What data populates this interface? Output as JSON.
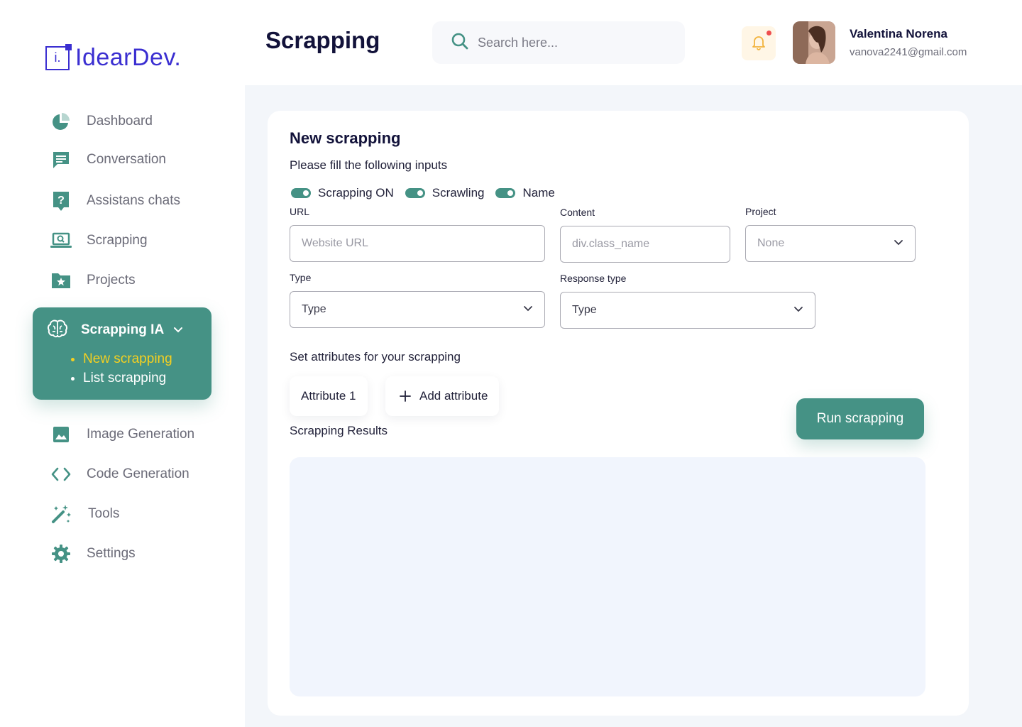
{
  "brand": {
    "logo_glyph": "i.",
    "name": "IdearDev.",
    "color": "#3b2fd1"
  },
  "colors": {
    "accent": "#459285",
    "active_sub": "#f5d020",
    "content_bg": "#f3f6fa",
    "notification_dot": "#ef4e4e"
  },
  "sidebar": {
    "items": [
      {
        "label": "Dashboard",
        "icon": "pie-chart-icon"
      },
      {
        "label": "Conversation",
        "icon": "chat-icon"
      },
      {
        "label": "Assistans chats",
        "icon": "question-chat-icon"
      },
      {
        "label": "Scrapping",
        "icon": "laptop-search-icon"
      },
      {
        "label": "Projects",
        "icon": "folder-star-icon"
      }
    ],
    "group": {
      "label": "Scrapping IA",
      "icon": "brain-icon",
      "subitems": [
        {
          "label": "New scrapping",
          "active": true
        },
        {
          "label": "List scrapping",
          "active": false
        }
      ]
    },
    "items_after": [
      {
        "label": "Image Generation",
        "icon": "image-icon"
      },
      {
        "label": "Code Generation",
        "icon": "code-icon"
      },
      {
        "label": "Tools",
        "icon": "magic-wand-icon"
      },
      {
        "label": "Settings",
        "icon": "gear-icon"
      }
    ]
  },
  "header": {
    "title": "Scrapping",
    "search_placeholder": "Search here...",
    "user": {
      "name": "Valentina Norena",
      "email": "vanova2241@gmail.com"
    }
  },
  "form": {
    "heading": "New scrapping",
    "subtitle": "Please fill the following inputs",
    "toggles": [
      {
        "label": "Scrapping ON",
        "on": true
      },
      {
        "label": "Scrawling",
        "on": true
      },
      {
        "label": "Name",
        "on": true
      }
    ],
    "url": {
      "label": "URL",
      "placeholder": "Website URL"
    },
    "content": {
      "label": "Content",
      "placeholder": "div.class_name"
    },
    "project": {
      "label": "Project",
      "value": "None"
    },
    "type": {
      "label": "Type",
      "value": "Type"
    },
    "response_type": {
      "label": "Response type",
      "value": "Type"
    },
    "attributes_heading": "Set attributes for your scrapping",
    "attributes": [
      "Attribute 1"
    ],
    "add_attribute": "Add attribute",
    "run_button": "Run scrapping",
    "results_label": "Scrapping Results"
  }
}
